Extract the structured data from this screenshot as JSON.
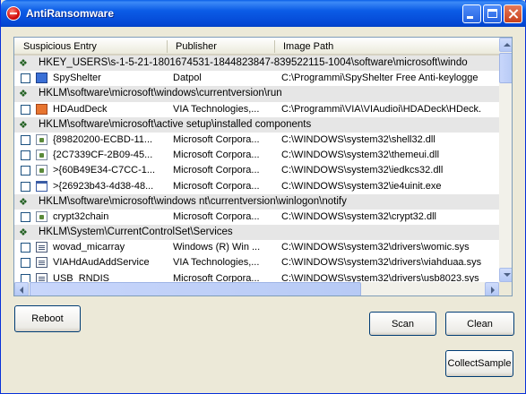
{
  "window": {
    "title": "AntiRansomware"
  },
  "columns": [
    "Suspicious Entry",
    "Publisher",
    "Image Path"
  ],
  "rows": [
    {
      "type": "group",
      "text": "HKEY_USERS\\s-1-5-21-1801674531-1844823847-839522115-1004\\software\\microsoft\\windo"
    },
    {
      "type": "entry",
      "icon": "shield-app-icon",
      "entry": "SpyShelter",
      "publisher": "Datpol",
      "path": "C:\\Programmi\\SpyShelter Free Anti-keylogge"
    },
    {
      "type": "group",
      "text": "HKLM\\software\\microsoft\\windows\\currentversion\\run"
    },
    {
      "type": "entry",
      "icon": "mail-app-icon",
      "entry": "HDAudDeck",
      "publisher": "VIA Technologies,...",
      "path": "C:\\Programmi\\VIA\\VIAudioi\\HDADeck\\HDeck."
    },
    {
      "type": "group",
      "text": "HKLM\\software\\microsoft\\active setup\\installed components"
    },
    {
      "type": "entry",
      "icon": "dll-file-icon",
      "entry": "{89820200-ECBD-11...",
      "publisher": "Microsoft Corpora...",
      "path": "C:\\WINDOWS\\system32\\shell32.dll"
    },
    {
      "type": "entry",
      "icon": "dll-file-icon",
      "entry": "{2C7339CF-2B09-45...",
      "publisher": "Microsoft Corpora...",
      "path": "C:\\WINDOWS\\system32\\themeui.dll"
    },
    {
      "type": "entry",
      "icon": "dll-file-icon",
      "entry": ">{60B49E34-C7CC-1...",
      "publisher": "Microsoft Corpora...",
      "path": "C:\\WINDOWS\\system32\\iedkcs32.dll"
    },
    {
      "type": "entry",
      "icon": "window-app-icon",
      "entry": ">{26923b43-4d38-48...",
      "publisher": "Microsoft Corpora...",
      "path": "C:\\WINDOWS\\system32\\ie4uinit.exe"
    },
    {
      "type": "group",
      "text": "HKLM\\software\\microsoft\\windows nt\\currentversion\\winlogon\\notify"
    },
    {
      "type": "entry",
      "icon": "dll-file-icon",
      "entry": "crypt32chain",
      "publisher": "Microsoft Corpora...",
      "path": "C:\\WINDOWS\\system32\\crypt32.dll"
    },
    {
      "type": "group",
      "text": "HKLM\\System\\CurrentControlSet\\Services"
    },
    {
      "type": "entry",
      "icon": "system-file-icon",
      "entry": "wovad_micarray",
      "publisher": "Windows (R) Win ...",
      "path": "C:\\WINDOWS\\system32\\drivers\\womic.sys"
    },
    {
      "type": "entry",
      "icon": "system-file-icon",
      "entry": "VIAHdAudAddService",
      "publisher": "VIA Technologies,...",
      "path": "C:\\WINDOWS\\system32\\drivers\\viahduaa.sys"
    },
    {
      "type": "entry",
      "icon": "system-file-icon",
      "entry": "USB_RNDIS",
      "publisher": "Microsoft Corpora...",
      "path": "C:\\WINDOWS\\system32\\drivers\\usb8023.sys"
    }
  ],
  "buttons": {
    "reboot": "Reboot",
    "scan": "Scan",
    "clean": "Clean",
    "collect": "CollectSample"
  }
}
